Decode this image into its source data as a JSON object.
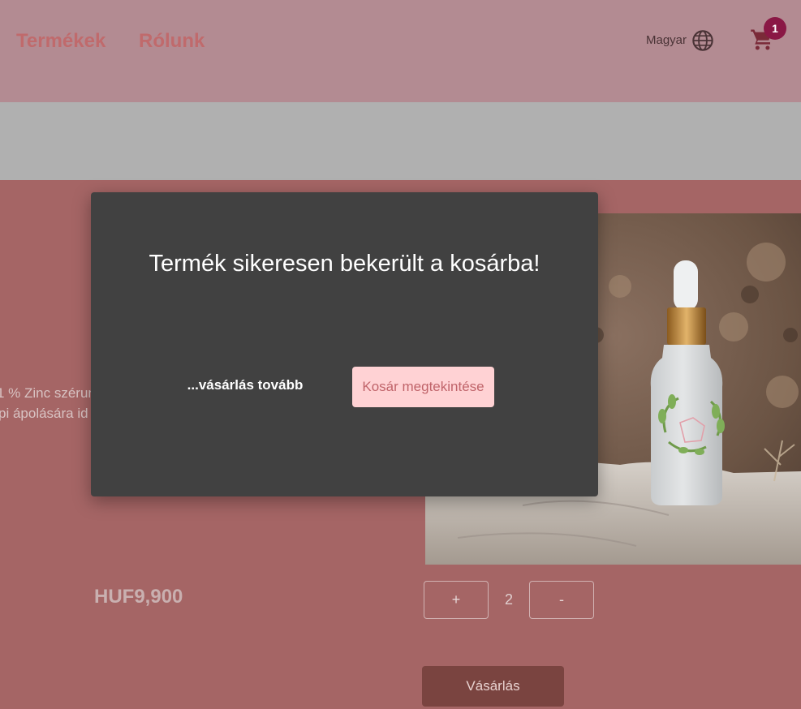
{
  "header": {
    "nav": [
      {
        "label": "Termékek"
      },
      {
        "label": "Rólunk"
      }
    ],
    "language_label": "Magyar",
    "cart_count": "1",
    "icons": {
      "language": "globe-icon",
      "cart": "cart-icon"
    },
    "colors": {
      "nav_link": "#c06a6c",
      "badge": "#8a1845"
    }
  },
  "product": {
    "description_lines": [
      "1 % Zinc szérum",
      "pi ápolására id"
    ],
    "price": "HUF9,900",
    "quantity": {
      "plus_label": "+",
      "value": "2",
      "minus_label": "-"
    },
    "buy_label": "Vásárlás"
  },
  "modal": {
    "title": "Termék sikeresen bekerült a kosárba!",
    "continue_label": "...vásárlás tovább",
    "view_cart_label": "Kosár megtekintése",
    "colors": {
      "background": "#414141",
      "view_cart_button": "#ffd2d4"
    }
  }
}
